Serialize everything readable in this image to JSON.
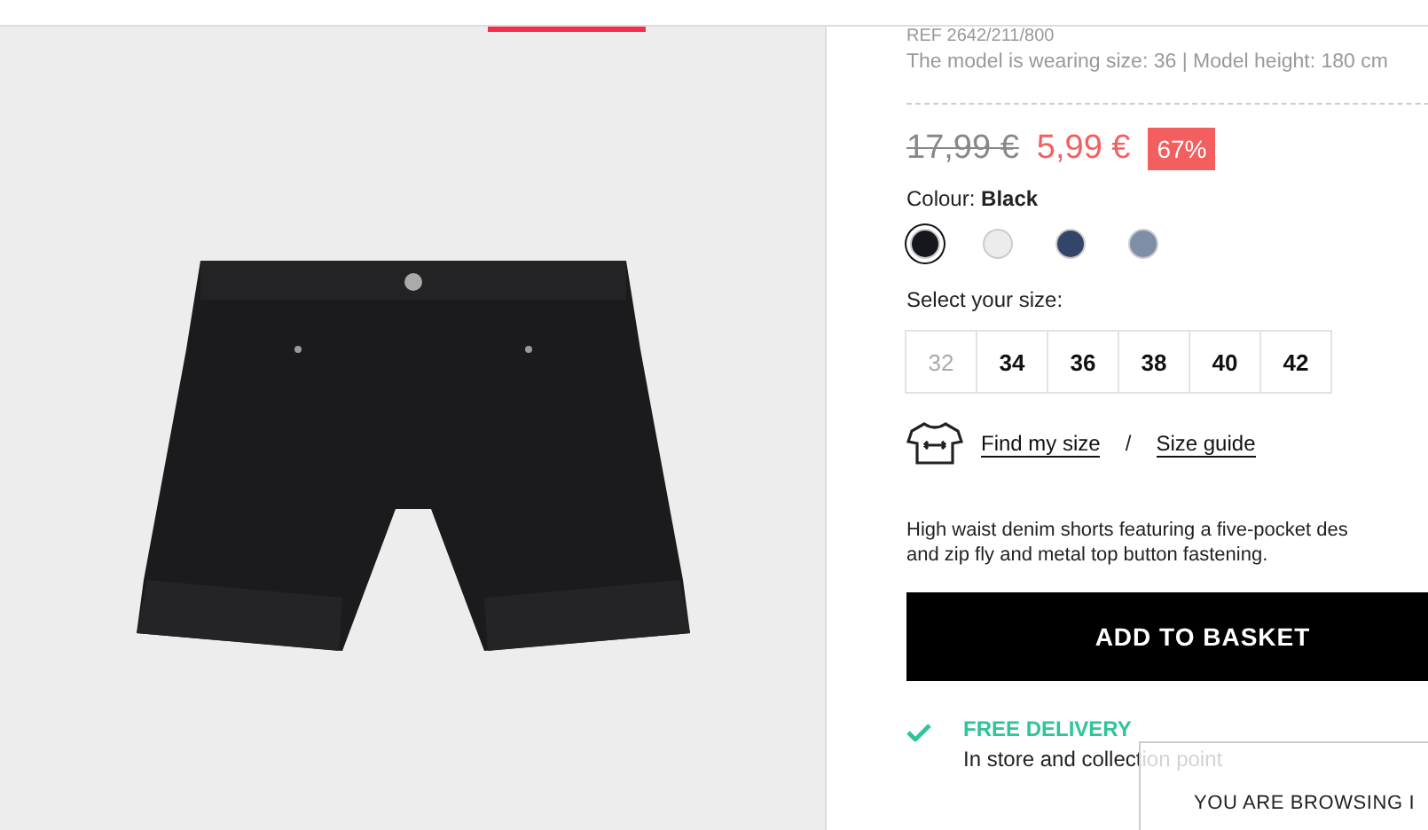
{
  "product": {
    "reference": "REF 2642/211/800",
    "model_info": "The model is wearing size: 36 | Model height: 180 cm",
    "old_price": "17,99 €",
    "price": "5,99 €",
    "discount": "67%",
    "colour_label": "Colour:",
    "colour_name": "Black",
    "colours": [
      {
        "color": "#15171c",
        "selected": true
      },
      {
        "color": "#ececec",
        "selected": false
      },
      {
        "color": "#34456a",
        "selected": false
      },
      {
        "color": "#7d8ea6",
        "selected": false
      }
    ],
    "size_label": "Select your size:",
    "sizes": [
      {
        "label": "32",
        "disabled": true
      },
      {
        "label": "34",
        "disabled": false
      },
      {
        "label": "36",
        "disabled": false
      },
      {
        "label": "38",
        "disabled": false
      },
      {
        "label": "40",
        "disabled": false
      },
      {
        "label": "42",
        "disabled": false
      }
    ],
    "find_size": "Find my size",
    "separator": "/",
    "size_guide": "Size guide",
    "description": "High waist denim shorts featuring a five-pocket des\nand zip fly and metal top button fastening.",
    "add_button": "ADD TO BASKET",
    "delivery_title": "FREE DELIVERY",
    "delivery_text": "In store and collection point"
  },
  "popup": {
    "text": "YOU ARE BROWSING I"
  }
}
